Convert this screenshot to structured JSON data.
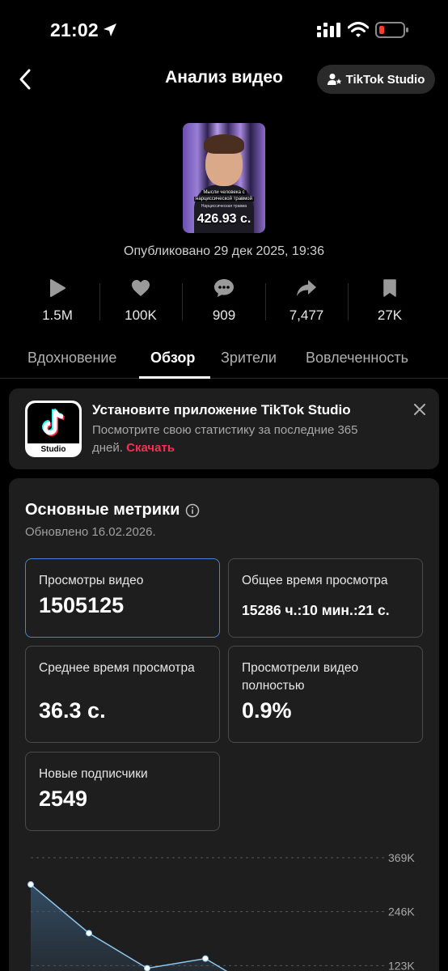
{
  "status_bar": {
    "time": "21:02",
    "icons": [
      "location-arrow-icon",
      "signal-icon",
      "wifi-icon",
      "battery-low-icon"
    ],
    "battery_color": "#ff3b30"
  },
  "header": {
    "back_icon": "chevron-left-icon",
    "title": "Анализ видео",
    "studio_button": "TikTok Studio",
    "studio_icon": "user-star-icon"
  },
  "video": {
    "duration": "426.93 с.",
    "thumb_caption_line1": "Мысли человека с",
    "thumb_caption_line2": "нарциссической травмой",
    "thumb_caption_sub": "Нарциссическая травма",
    "published": "Опубликовано 29 дек 2025, 19:36"
  },
  "stats": [
    {
      "icon": "play-icon",
      "value": "1.5M"
    },
    {
      "icon": "heart-icon",
      "value": "100K"
    },
    {
      "icon": "comment-icon",
      "value": "909"
    },
    {
      "icon": "share-icon",
      "value": "7,477"
    },
    {
      "icon": "bookmark-icon",
      "value": "27K"
    }
  ],
  "tabs": [
    {
      "label": "Вдохновение",
      "active": false
    },
    {
      "label": "Обзор",
      "active": true
    },
    {
      "label": "Зрители",
      "active": false
    },
    {
      "label": "Вовлеченность",
      "active": false
    }
  ],
  "promo": {
    "logo_label": "Studio",
    "title": "Установите приложение TikTok Studio",
    "text": "Посмотрите свою статистику за последние 365 дней.",
    "link": "Скачать",
    "close_icon": "close-icon"
  },
  "metrics": {
    "title": "Основные метрики",
    "info_icon": "info-icon",
    "updated": "Обновлено 16.02.2026.",
    "tiles": [
      {
        "label": "Просмотры видео",
        "value": "1505125",
        "selected": true
      },
      {
        "label": "Общее время просмотра",
        "value": "15286 ч.:10 мин.:21 с.",
        "selected": false
      },
      {
        "label": "Среднее время просмотра",
        "value": "36.3 с.",
        "selected": false
      },
      {
        "label": "Просмотрели видео полностью",
        "value": "0.9%",
        "selected": false
      },
      {
        "label": "Новые подписчики",
        "value": "2549",
        "selected": false
      }
    ]
  },
  "chart_data": {
    "type": "area",
    "title": "",
    "xlabel": "",
    "ylabel": "",
    "y_ticks": [
      "369K",
      "246K",
      "123K"
    ],
    "y_tick_values": [
      369000,
      246000,
      123000
    ],
    "ylim": [
      0,
      369000
    ],
    "series": [
      {
        "values": [
          308000,
          197000,
          117000,
          139000,
          60000
        ]
      }
    ],
    "grid": true,
    "colors": {
      "line": "#8ec8f0",
      "fill_top": "#3a5a78",
      "grid": "#555555"
    }
  }
}
